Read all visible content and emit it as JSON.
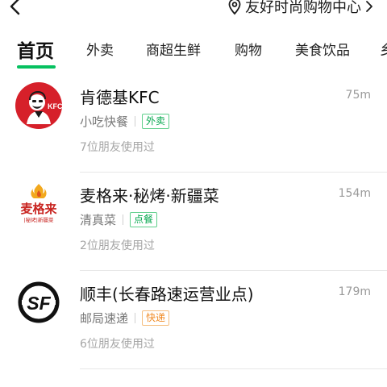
{
  "header": {
    "back_icon": "chevron-left-icon",
    "location_icon": "map-pin-icon",
    "location": "友好时尚购物中心",
    "location_chevron": "chevron-right-icon"
  },
  "tabs": [
    {
      "label": "首页",
      "active": true
    },
    {
      "label": "外卖",
      "active": false
    },
    {
      "label": "商超生鲜",
      "active": false
    },
    {
      "label": "购物",
      "active": false
    },
    {
      "label": "美食饮品",
      "active": false
    }
  ],
  "accent_color": "#06c160",
  "stores": [
    {
      "name": "肯德基KFC",
      "distance": "75m",
      "category": "小吃快餐",
      "tag": "外卖",
      "tag_color": "#06a84f",
      "friends": "7位朋友使用过",
      "logo_icon": "kfc-logo-icon",
      "logo_text": "KFC"
    },
    {
      "name": "麦格来·秘烤·新疆菜",
      "distance": "154m",
      "category": "清真菜",
      "tag": "点餐",
      "tag_color": "#06a84f",
      "friends": "2位朋友使用过",
      "logo_icon": "maigelai-logo-icon",
      "logo_text": "麦格来",
      "logo_subtext": "|秘烤|新疆菜"
    },
    {
      "name": "顺丰(长春路速运营业点)",
      "distance": "179m",
      "category": "邮局速递",
      "tag": "快递",
      "tag_color": "#f08a24",
      "friends": "6位朋友使用过",
      "logo_icon": "sf-express-logo-icon",
      "logo_text": "SF"
    }
  ]
}
